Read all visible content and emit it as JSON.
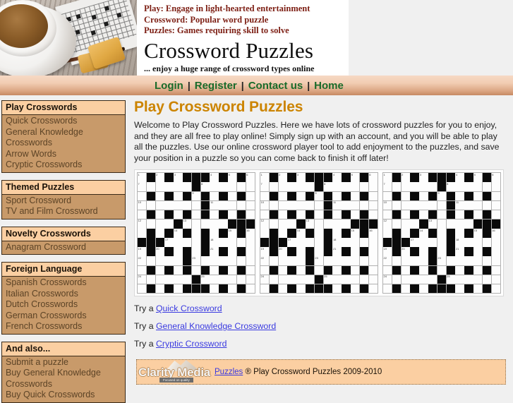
{
  "banner": {
    "tagline_1": "Play: Engage in light-hearted entertainment",
    "tagline_2": "Crossword: Popular word puzzle",
    "tagline_3": "Puzzles: Games requiring skill to solve",
    "title": "Crossword Puzzles",
    "subtitle": "... enjoy a huge range of crossword types online",
    "photo_alt": "coffee-cup-crossword-photo"
  },
  "nav": {
    "items": [
      {
        "label": "Login"
      },
      {
        "label": "Register"
      },
      {
        "label": "Contact us"
      },
      {
        "label": "Home"
      }
    ],
    "separator": "|",
    "link_color": "#1a6b2a"
  },
  "sidebar": {
    "sections": [
      {
        "title": "Play Crosswords",
        "items": [
          {
            "label": "Quick Crosswords"
          },
          {
            "label": "General Knowledge Crosswords"
          },
          {
            "label": "Arrow Words"
          },
          {
            "label": "Cryptic Crosswords"
          }
        ]
      },
      {
        "title": "Themed Puzzles",
        "items": [
          {
            "label": "Sport Crossword"
          },
          {
            "label": "TV and Film Crossword"
          }
        ]
      },
      {
        "title": "Novelty Crosswords",
        "items": [
          {
            "label": "Anagram Crossword"
          }
        ]
      },
      {
        "title": "Foreign Language",
        "items": [
          {
            "label": "Spanish Crosswords"
          },
          {
            "label": "Italian Crosswords"
          },
          {
            "label": "Dutch Crosswords"
          },
          {
            "label": "German Crosswords"
          },
          {
            "label": "French Crosswords"
          }
        ]
      },
      {
        "title": "And also...",
        "items": [
          {
            "label": "Submit a puzzle"
          },
          {
            "label": "Buy General Knowledge Crosswords"
          },
          {
            "label": "Buy Quick Crosswords"
          }
        ]
      }
    ],
    "header_bg": "#fbcfa2",
    "body_bg": "#c89a6a"
  },
  "main": {
    "title": "Play Crossword Puzzles",
    "title_color": "#cc8400",
    "intro": "Welcome to Play Crossword Puzzles. Here we have lots of crossword puzzles for you to enjoy, and they are all free to play online! Simply sign up with an account, and you will be able to play all the puzzles. Use our online crossword player tool to add enjoyment to the puzzles, and save your position in a puzzle so you can come back to finish it off later!",
    "try_links": [
      {
        "prefix": "Try a",
        "label": "Quick Crossword"
      },
      {
        "prefix": "Try a",
        "label": "General Knowledge Crossword"
      },
      {
        "prefix": "Try a",
        "label": "Cryptic Crossword"
      }
    ],
    "link_color": "#3a3ae0"
  },
  "crossword_banner": {
    "alt": "crossword-grid-banner",
    "tile_repeat": 3,
    "size": 13,
    "black_squares": [
      [
        0,
        1
      ],
      [
        0,
        3
      ],
      [
        0,
        5
      ],
      [
        0,
        6
      ],
      [
        0,
        7
      ],
      [
        0,
        9
      ],
      [
        0,
        11
      ],
      [
        1,
        6
      ],
      [
        2,
        1
      ],
      [
        2,
        3
      ],
      [
        2,
        5
      ],
      [
        2,
        7
      ],
      [
        2,
        9
      ],
      [
        2,
        11
      ],
      [
        3,
        7
      ],
      [
        4,
        1
      ],
      [
        4,
        3
      ],
      [
        4,
        5
      ],
      [
        4,
        7
      ],
      [
        4,
        9
      ],
      [
        4,
        11
      ],
      [
        5,
        4
      ],
      [
        5,
        10
      ],
      [
        5,
        11
      ],
      [
        5,
        12
      ],
      [
        6,
        1
      ],
      [
        6,
        3
      ],
      [
        6,
        5
      ],
      [
        6,
        7
      ],
      [
        6,
        9
      ],
      [
        6,
        11
      ],
      [
        7,
        0
      ],
      [
        7,
        1
      ],
      [
        7,
        2
      ],
      [
        7,
        7
      ],
      [
        8,
        1
      ],
      [
        8,
        3
      ],
      [
        8,
        5
      ],
      [
        8,
        7
      ],
      [
        8,
        9
      ],
      [
        8,
        11
      ],
      [
        9,
        5
      ],
      [
        10,
        1
      ],
      [
        10,
        3
      ],
      [
        10,
        5
      ],
      [
        10,
        7
      ],
      [
        10,
        9
      ],
      [
        10,
        11
      ],
      [
        11,
        6
      ],
      [
        12,
        1
      ],
      [
        12,
        3
      ],
      [
        12,
        5
      ],
      [
        12,
        6
      ],
      [
        12,
        7
      ],
      [
        12,
        9
      ],
      [
        12,
        11
      ]
    ],
    "numbers": [
      {
        "r": 0,
        "c": 0,
        "n": "1"
      },
      {
        "r": 0,
        "c": 2,
        "n": "2"
      },
      {
        "r": 0,
        "c": 4,
        "n": "3"
      },
      {
        "r": 0,
        "c": 8,
        "n": "4"
      },
      {
        "r": 0,
        "c": 10,
        "n": "5"
      },
      {
        "r": 0,
        "c": 12,
        "n": "6"
      },
      {
        "r": 1,
        "c": 0,
        "n": "7"
      },
      {
        "r": 1,
        "c": 7,
        "n": "8"
      },
      {
        "r": 2,
        "c": 6,
        "n": "9"
      },
      {
        "r": 3,
        "c": 0,
        "n": "10"
      },
      {
        "r": 3,
        "c": 8,
        "n": "11"
      },
      {
        "r": 5,
        "c": 0,
        "n": "12"
      },
      {
        "r": 5,
        "c": 5,
        "n": "13"
      },
      {
        "r": 6,
        "c": 4,
        "n": "14"
      },
      {
        "r": 6,
        "c": 10,
        "n": "15"
      },
      {
        "r": 6,
        "c": 12,
        "n": "16"
      },
      {
        "r": 7,
        "c": 3,
        "n": "17"
      },
      {
        "r": 7,
        "c": 8,
        "n": "18"
      },
      {
        "r": 8,
        "c": 0,
        "n": "19"
      },
      {
        "r": 8,
        "c": 2,
        "n": "20"
      },
      {
        "r": 8,
        "c": 8,
        "n": "21"
      },
      {
        "r": 9,
        "c": 0,
        "n": "22"
      },
      {
        "r": 9,
        "c": 6,
        "n": "23"
      },
      {
        "r": 11,
        "c": 0,
        "n": "24"
      },
      {
        "r": 11,
        "c": 7,
        "n": "25"
      }
    ]
  },
  "footer": {
    "logo_name": "Clarity Media",
    "logo_tagline": "Focused on quality",
    "link_label": "Puzzles",
    "text": "® Play Crossword Puzzles 2009-2010"
  }
}
